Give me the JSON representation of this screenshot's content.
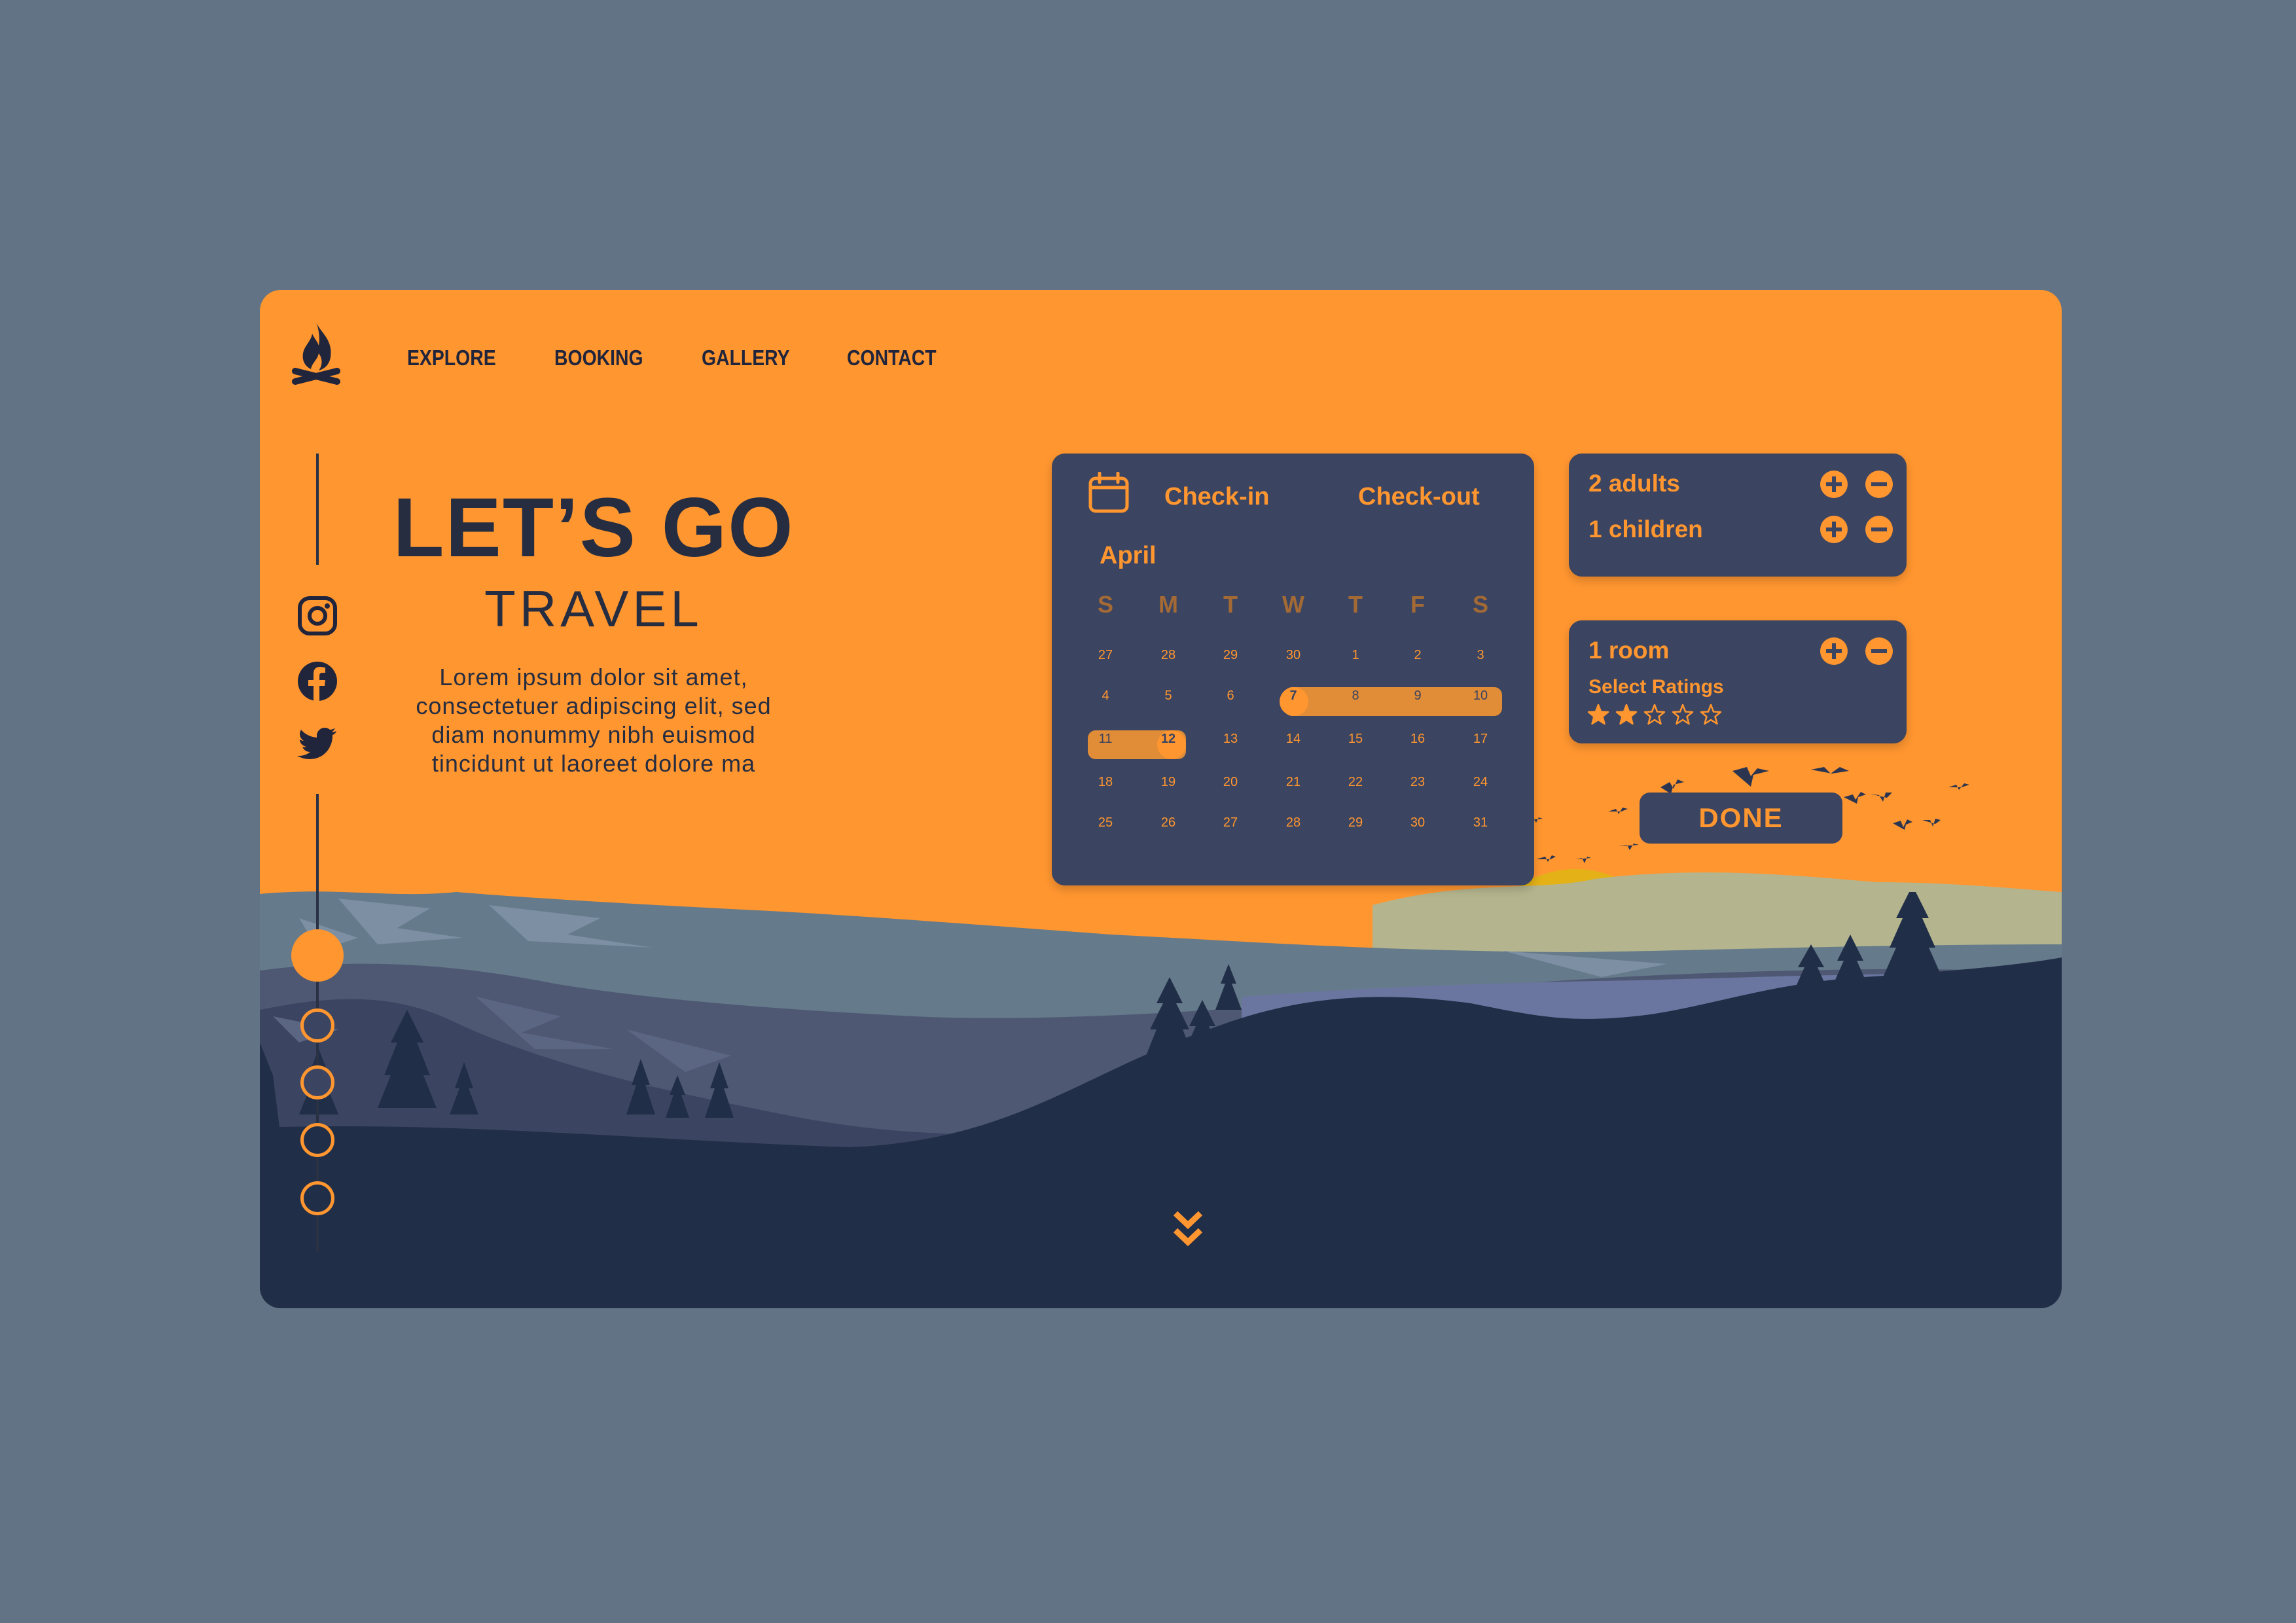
{
  "colors": {
    "accent": "#FF9630",
    "dark": "#20253C",
    "panel": "#3B4460",
    "backdrop": "#627385"
  },
  "nav": {
    "items": [
      "EXPLORE",
      "BOOKING",
      "GALLERY",
      "CONTACT"
    ]
  },
  "social": [
    "instagram-icon",
    "facebook-icon",
    "twitter-icon"
  ],
  "hero": {
    "title": "LET’S GO",
    "subtitle": "TRAVEL",
    "text_lines": [
      "Lorem ipsum dolor sit amet,",
      "consectetuer adipiscing elit, sed",
      "diam nonummy nibh euismod",
      "tincidunt ut laoreet dolore ma"
    ]
  },
  "calendar": {
    "checkin_label": "Check-in",
    "checkout_label": "Check-out",
    "month": "April",
    "weekdays": [
      "S",
      "M",
      "T",
      "W",
      "T",
      "F",
      "S"
    ],
    "weeks": [
      [
        "27",
        "28",
        "29",
        "30",
        "1",
        "2",
        "3"
      ],
      [
        "4",
        "5",
        "6",
        "7",
        "8",
        "9",
        "10"
      ],
      [
        "11",
        "12",
        "13",
        "14",
        "15",
        "16",
        "17"
      ],
      [
        "18",
        "19",
        "20",
        "21",
        "22",
        "23",
        "24"
      ],
      [
        "25",
        "26",
        "27",
        "28",
        "29",
        "30",
        "31"
      ]
    ],
    "selected_start": "7",
    "selected_end": "12"
  },
  "guests": {
    "adults": "2 adults",
    "children": "1 children"
  },
  "rooms": {
    "rooms": "1 room",
    "ratings_label": "Select Ratings",
    "rating": 2,
    "max_rating": 5
  },
  "done_label": "DONE",
  "pagination": {
    "total": 5,
    "active": 1
  }
}
